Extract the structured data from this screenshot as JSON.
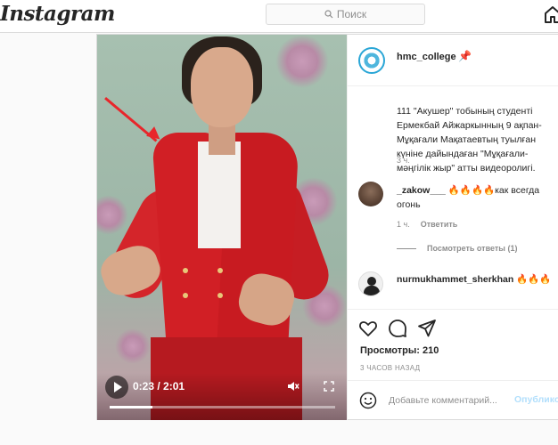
{
  "app": {
    "logo": "Instagram"
  },
  "search": {
    "placeholder": "Поиск"
  },
  "video": {
    "time": "0:23 / 2:01",
    "progress_fraction": 0.19
  },
  "post": {
    "username": "hmc_college",
    "pin_emoji": "📌",
    "caption": "111 \"Акушер\" тобының студенті Ермекбай Айжаркынның 9 ақпан-Мұқағали Мақатаевтың туылған күніне дайындаған \"Мұқағали-мәңгілік жыр\" атты видеоролигі.",
    "caption_time": "3 ч.",
    "views_label": "Просмотры: 210",
    "posted_ago": "3 ЧАСОВ НАЗАД"
  },
  "comments": [
    {
      "username": "_zakow___",
      "text": "🔥🔥🔥🔥как всегда огонь",
      "time": "1 ч.",
      "reply_label": "Ответить",
      "view_replies": "Посмотреть ответы (1)"
    },
    {
      "username": "nurmukhammet_sherkhan",
      "text": "🔥🔥🔥"
    }
  ],
  "add_comment": {
    "placeholder": "Добавьте комментарий...",
    "publish_label": "Опубликовать"
  },
  "colors": {
    "accent_blue": "#0095f6",
    "arrow_red": "#e8262b",
    "jacket_red": "#d11f25"
  }
}
